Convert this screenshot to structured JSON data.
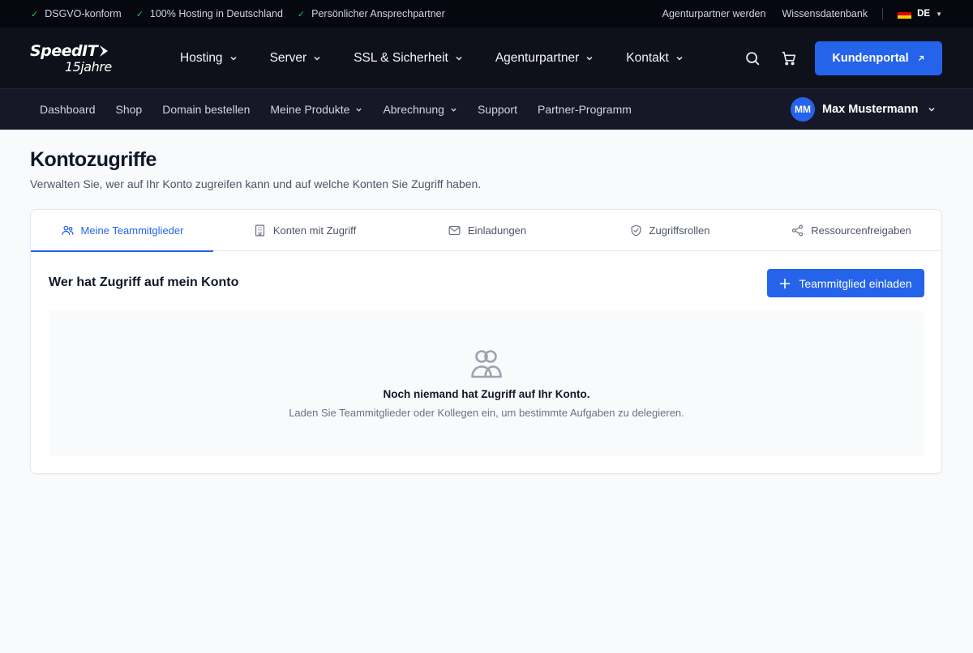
{
  "topbar": {
    "trust_items": [
      "DSGVO-konform",
      "100% Hosting in Deutschland",
      "Persönlicher Ansprechpartner"
    ],
    "check_glyph": "✓",
    "links": [
      "Agenturpartner werden",
      "Wissensdatenbank"
    ],
    "language": "DE",
    "flag_colors": [
      "#000000",
      "#dd0000",
      "#ffce00"
    ]
  },
  "logo": {
    "name": "SpeedIT",
    "tagline": "15jahre"
  },
  "main_nav": {
    "items": [
      "Hosting",
      "Server",
      "SSL & Sicherheit",
      "Agenturpartner",
      "Kontakt"
    ],
    "icons": [
      "search-icon",
      "cart-icon"
    ],
    "portal_button": "Kundenportal"
  },
  "sub_nav": {
    "items": [
      "Dashboard",
      "Shop",
      "Domain bestellen",
      "Meine Produkte",
      "Abrechnung",
      "Support",
      "Partner-Programm"
    ],
    "dropdown_items": [
      "Meine Produkte",
      "Abrechnung"
    ],
    "user": {
      "initials": "MM",
      "name": "Max Mustermann"
    }
  },
  "page": {
    "title": "Kontozugriffe",
    "subtitle": "Verwalten Sie, wer auf Ihr Konto zugreifen kann und auf welche Konten Sie Zugriff haben."
  },
  "tabs": [
    {
      "label": "Meine Teammitglieder",
      "icon": "users-icon",
      "active": true
    },
    {
      "label": "Konten mit Zugriff",
      "icon": "building-icon",
      "active": false
    },
    {
      "label": "Einladungen",
      "icon": "mail-icon",
      "active": false
    },
    {
      "label": "Zugriffsrollen",
      "icon": "shield-check-icon",
      "active": false
    },
    {
      "label": "Ressourcenfreigaben",
      "icon": "share-icon",
      "active": false
    }
  ],
  "section": {
    "title": "Wer hat Zugriff auf mein Konto",
    "invite_button": "Teammitglied einladen",
    "empty_icon": "users-icon",
    "empty_title": "Noch niemand hat Zugriff auf Ihr Konto.",
    "empty_text": "Laden Sie Teammitglieder oder Kollegen ein, um bestimmte Aufgaben zu delegieren."
  },
  "colors": {
    "accent": "#2563eb",
    "topbar_bg": "#07080f",
    "nav_bg": "#0f111a",
    "subnav_bg": "#161827",
    "check": "#22c55e"
  }
}
